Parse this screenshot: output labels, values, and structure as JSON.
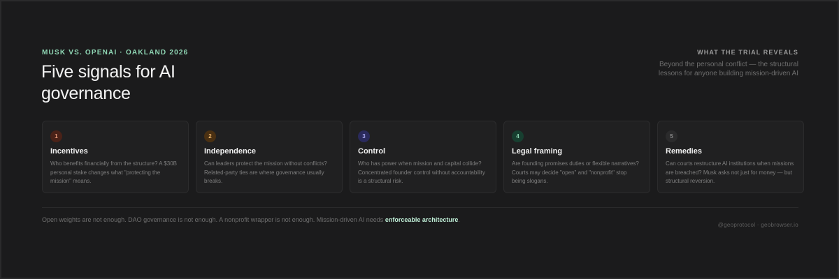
{
  "header": {
    "eyebrow": "MUSK VS. OPENAI · OAKLAND 2026",
    "title": "Five signals for AI governance",
    "right_label": "WHAT THE TRIAL REVEALS",
    "right_desc": "Beyond the personal conflict — the structural lessons for anyone building mission-driven AI"
  },
  "cards": [
    {
      "number": "1",
      "title": "Incentives",
      "desc": "Who benefits financially from the structure? A $30B personal stake changes what \"protecting the mission\" means.",
      "badge_bg": "#4a2218",
      "badge_color": "#e79a7a"
    },
    {
      "number": "2",
      "title": "Independence",
      "desc": "Can leaders protect the mission without conflicts? Related-party ties are where governance usually breaks.",
      "badge_bg": "#4a3012",
      "badge_color": "#eab46a"
    },
    {
      "number": "3",
      "title": "Control",
      "desc": "Who has power when mission and capital collide? Concentrated founder control without accountability is a structural risk.",
      "badge_bg": "#2a2a5c",
      "badge_color": "#a9a9f0"
    },
    {
      "number": "4",
      "title": "Legal framing",
      "desc": "Are founding promises duties or flexible narratives? Courts may decide \"open\" and \"nonprofit\" stop being slogans.",
      "badge_bg": "#173f30",
      "badge_color": "#8fd6b4"
    },
    {
      "number": "5",
      "title": "Remedies",
      "desc": "Can courts restructure AI institutions when missions are breached? Musk asks not just for money — but structural reversion.",
      "badge_bg": "#2b2b2c",
      "badge_color": "#8a8a8a"
    }
  ],
  "footer": {
    "text": "Open weights are not enough. DAO governance is not enough. A nonprofit wrapper is not enough. Mission-driven AI needs",
    "emphasis": "enforceable architecture",
    "end": ".",
    "handle": "@geoprotocol · geobrowser.io"
  }
}
